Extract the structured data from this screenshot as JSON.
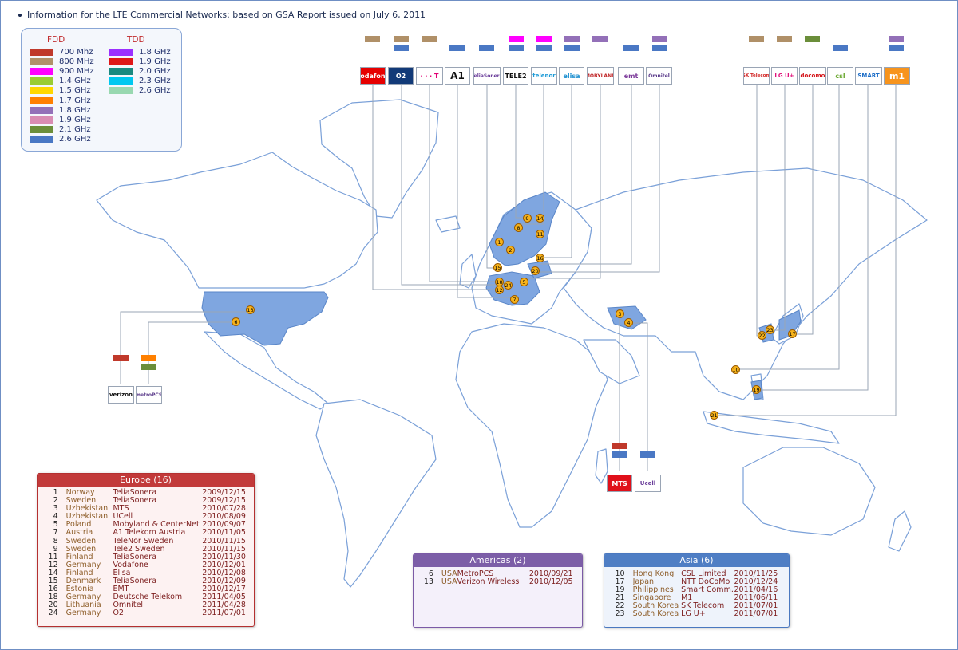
{
  "title": "Information for the LTE Commercial Networks: based on GSA Report issued on July 6, 2011",
  "colors": {
    "700MHz": "#c0392b",
    "800MHz": "#b09068",
    "900MHz": "#ff00ff",
    "1.4GHz": "#9acd32",
    "1.5GHz": "#ffd700",
    "1.7GHz": "#ff8000",
    "1.8GHz_fdd": "#9370b8",
    "1.9GHz_fdd": "#d98cb3",
    "2.1GHz": "#6b8e3a",
    "2.6GHz_fdd": "#4a78c4",
    "1.8GHz_tdd": "#9b30ff",
    "1.9GHz_tdd": "#e01818",
    "2.0GHz": "#1a8a80",
    "2.3GHz": "#00c8f0",
    "2.6GHz_tdd": "#98d8b0",
    "land": "#ffffff",
    "coast": "#7aa0d8",
    "highlight": "#7fa6e0"
  },
  "legend": {
    "fdd_title": "FDD",
    "tdd_title": "TDD",
    "fdd": [
      {
        "label": "700 Mhz",
        "color": "#c0392b"
      },
      {
        "label": "800 MHz",
        "color": "#b09068"
      },
      {
        "label": "900 MHz",
        "color": "#ff00ff"
      },
      {
        "label": "1.4 GHz",
        "color": "#9acd32"
      },
      {
        "label": "1.5 GHz",
        "color": "#ffd700"
      },
      {
        "label": "1.7 GHz",
        "color": "#ff8000"
      },
      {
        "label": "1.8 GHz",
        "color": "#9370b8"
      },
      {
        "label": "1.9 GHz",
        "color": "#d98cb3"
      },
      {
        "label": "2.1 GHz",
        "color": "#6b8e3a"
      },
      {
        "label": "2.6 GHz",
        "color": "#4a78c4"
      }
    ],
    "tdd": [
      {
        "label": "1.8 GHz",
        "color": "#9b30ff"
      },
      {
        "label": "1.9 GHz",
        "color": "#e01818"
      },
      {
        "label": "2.0 GHz",
        "color": "#1a8a80"
      },
      {
        "label": "2.3 GHz",
        "color": "#00c8f0"
      },
      {
        "label": "2.6 GHz",
        "color": "#98d8b0"
      }
    ]
  },
  "operators": {
    "vodafone": "vodafone",
    "o2": "O2",
    "telekom": "· · · T",
    "a1": "A1",
    "teliasonera": "TeliaSonera",
    "tele2": "TELE2",
    "telenor": "telenor",
    "elisa": "elisa",
    "mobyland": "MOBYLAND",
    "emt": "emt",
    "omnitel": "Omnitel",
    "sktelecom": "SK Telecom",
    "lgu": "LG U+",
    "docomo": "docomo",
    "csl": "csl",
    "smart": "SMART",
    "m1": "m1",
    "verizon": "verizon",
    "metropcs": "metroPCS",
    "mts": "MTS",
    "ucell": "Ucell"
  },
  "pins": [
    "1",
    "2",
    "3",
    "4",
    "5",
    "6",
    "7",
    "8",
    "9",
    "10",
    "11",
    "12",
    "13",
    "14",
    "15",
    "16",
    "17",
    "18",
    "19",
    "20",
    "21",
    "22",
    "23",
    "24"
  ],
  "europe": {
    "title": "Europe (16)",
    "rows": [
      {
        "n": "1",
        "country": "Norway",
        "op": "TeliaSonera",
        "date": "2009/12/15"
      },
      {
        "n": "2",
        "country": "Sweden",
        "op": "TeliaSonera",
        "date": "2009/12/15"
      },
      {
        "n": "3",
        "country": "Uzbekistan",
        "op": "MTS",
        "date": "2010/07/28"
      },
      {
        "n": "4",
        "country": "Uzbekistan",
        "op": "UCell",
        "date": "2010/08/09"
      },
      {
        "n": "5",
        "country": "Poland",
        "op": "Mobyland & CenterNet",
        "date": "2010/09/07"
      },
      {
        "n": "7",
        "country": "Austria",
        "op": "A1 Telekom Austria",
        "date": "2010/11/05"
      },
      {
        "n": "8",
        "country": "Sweden",
        "op": "TeleNor Sweden",
        "date": "2010/11/15"
      },
      {
        "n": "9",
        "country": "Sweden",
        "op": "Tele2 Sweden",
        "date": "2010/11/15"
      },
      {
        "n": "11",
        "country": "Finland",
        "op": "TeliaSonera",
        "date": "2010/11/30"
      },
      {
        "n": "12",
        "country": "Germany",
        "op": "Vodafone",
        "date": "2010/12/01"
      },
      {
        "n": "14",
        "country": "Finland",
        "op": "Elisa",
        "date": "2010/12/08"
      },
      {
        "n": "15",
        "country": "Denmark",
        "op": "TeliaSonera",
        "date": "2010/12/09"
      },
      {
        "n": "16",
        "country": "Estonia",
        "op": "EMT",
        "date": "2010/12/17"
      },
      {
        "n": "18",
        "country": "Germany",
        "op": "Deutsche Telekom",
        "date": "2011/04/05"
      },
      {
        "n": "20",
        "country": "Lithuania",
        "op": "Omnitel",
        "date": "2011/04/28"
      },
      {
        "n": "24",
        "country": "Germany",
        "op": "O2",
        "date": "2011/07/01"
      }
    ]
  },
  "americas": {
    "title": "Americas (2)",
    "rows": [
      {
        "n": "6",
        "country": "USA",
        "op": "MetroPCS",
        "date": "2010/09/21"
      },
      {
        "n": "13",
        "country": "USA",
        "op": "Verizon Wireless",
        "date": "2010/12/05"
      }
    ]
  },
  "asia": {
    "title": "Asia (6)",
    "rows": [
      {
        "n": "10",
        "country": "Hong Kong",
        "op": "CSL Limited",
        "date": "2010/11/25"
      },
      {
        "n": "17",
        "country": "Japan",
        "op": "NTT DoCoMo",
        "date": "2010/12/24"
      },
      {
        "n": "19",
        "country": "Philippines",
        "op": "Smart Comm.",
        "date": "2011/04/16"
      },
      {
        "n": "21",
        "country": "Singapore",
        "op": "M1",
        "date": "2011/06/11"
      },
      {
        "n": "22",
        "country": "South Korea",
        "op": "SK Telecom",
        "date": "2011/07/01"
      },
      {
        "n": "23",
        "country": "South Korea",
        "op": "LG U+",
        "date": "2011/07/01"
      }
    ]
  }
}
